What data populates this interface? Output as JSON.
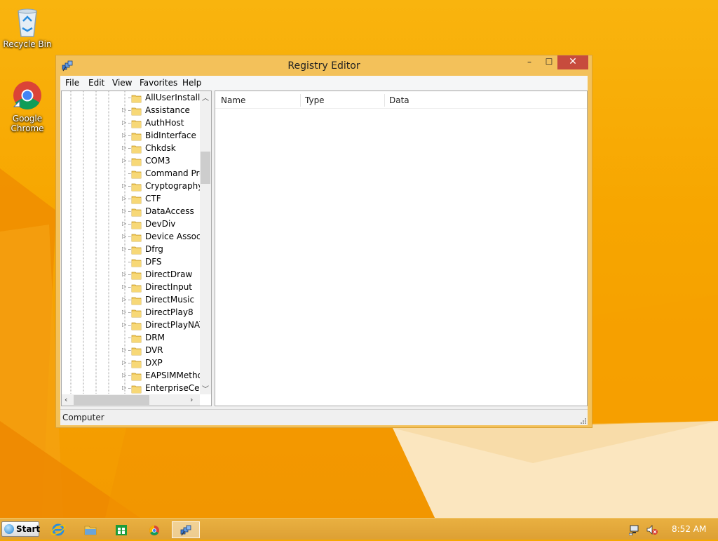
{
  "desktop": {
    "icons": [
      {
        "label": "Recycle Bin",
        "icon": "recycle-bin-icon"
      },
      {
        "label": "Google Chrome",
        "icon": "chrome-icon"
      }
    ]
  },
  "window": {
    "title": "Registry Editor",
    "icon": "registry-editor-icon",
    "controls": {
      "minimize": "–",
      "maximize": "☐",
      "close": "✕"
    },
    "menu": [
      "File",
      "Edit",
      "View",
      "Favorites",
      "Help"
    ],
    "tree": {
      "items": [
        {
          "label": "AllUserInstallA",
          "expandable": false
        },
        {
          "label": "Assistance",
          "expandable": true
        },
        {
          "label": "AuthHost",
          "expandable": true
        },
        {
          "label": "BidInterface",
          "expandable": true
        },
        {
          "label": "Chkdsk",
          "expandable": true
        },
        {
          "label": "COM3",
          "expandable": true
        },
        {
          "label": "Command Pro",
          "expandable": false
        },
        {
          "label": "Cryptography",
          "expandable": true
        },
        {
          "label": "CTF",
          "expandable": true
        },
        {
          "label": "DataAccess",
          "expandable": true
        },
        {
          "label": "DevDiv",
          "expandable": true
        },
        {
          "label": "Device Associa",
          "expandable": true
        },
        {
          "label": "Dfrg",
          "expandable": true
        },
        {
          "label": "DFS",
          "expandable": false
        },
        {
          "label": "DirectDraw",
          "expandable": true
        },
        {
          "label": "DirectInput",
          "expandable": true
        },
        {
          "label": "DirectMusic",
          "expandable": true
        },
        {
          "label": "DirectPlay8",
          "expandable": true
        },
        {
          "label": "DirectPlayNAT",
          "expandable": true
        },
        {
          "label": "DRM",
          "expandable": false
        },
        {
          "label": "DVR",
          "expandable": true
        },
        {
          "label": "DXP",
          "expandable": true
        },
        {
          "label": "EAPSIMMetho",
          "expandable": true
        },
        {
          "label": "EnterpriseCerti",
          "expandable": true
        }
      ]
    },
    "list": {
      "columns": [
        "Name",
        "Type",
        "Data"
      ]
    },
    "status": "Computer"
  },
  "taskbar": {
    "start_label": "Start",
    "pinned": [
      "internet-explorer-icon",
      "file-explorer-icon",
      "store-icon",
      "chrome-icon",
      "registry-editor-icon"
    ],
    "active": "registry-editor-icon",
    "clock": "8:52 AM"
  },
  "colors": {
    "desktop": "#f7a600",
    "window_frame": "#f3c15a",
    "close_button": "#c74b3d"
  }
}
